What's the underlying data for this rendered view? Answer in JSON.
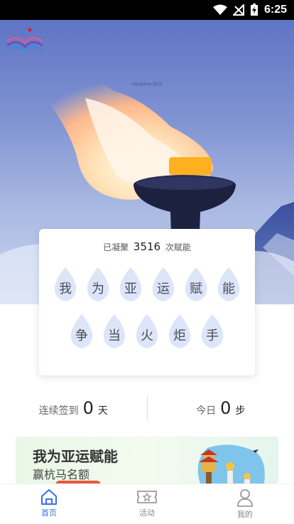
{
  "status_bar": {
    "time": "6:25"
  },
  "hero": {
    "logo_text": "Hangzhou 2022"
  },
  "card": {
    "prefix": "已凝聚",
    "count": "3516",
    "suffix": "次赋能",
    "row1": [
      "我",
      "为",
      "亚",
      "运",
      "赋",
      "能"
    ],
    "row2": [
      "争",
      "当",
      "火",
      "炬",
      "手"
    ]
  },
  "stats": {
    "checkin_label": "连续签到",
    "checkin_value": "0",
    "checkin_unit": "天",
    "steps_label": "今日",
    "steps_value": "0",
    "steps_unit": "步"
  },
  "banner": {
    "title": "我为亚运赋能",
    "subtitle": "赢杭马名额"
  },
  "nav": {
    "home": "首页",
    "activity": "活动",
    "me": "我的"
  },
  "colors": {
    "accent": "#3d6ee8",
    "flame_bg": "#dde6f8"
  }
}
